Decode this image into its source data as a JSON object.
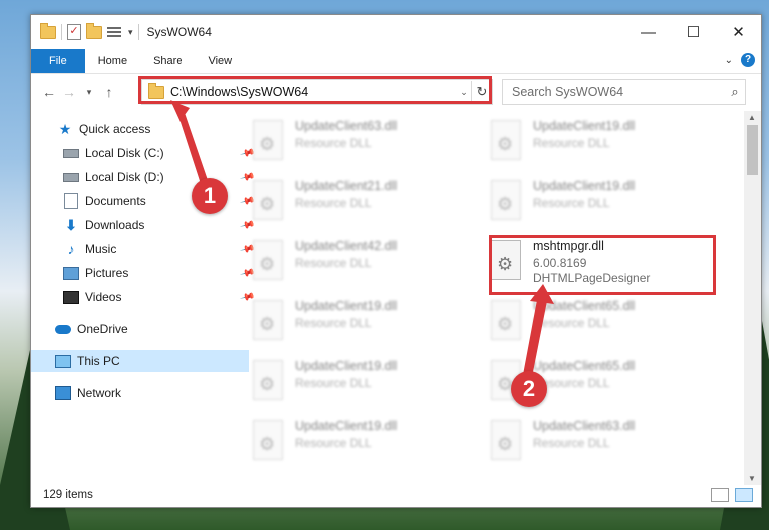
{
  "window": {
    "title": "SysWOW64",
    "controls": {
      "minimize": "—",
      "maximize": "☐",
      "close": "✕"
    }
  },
  "ribbon": {
    "tabs": [
      "File",
      "Home",
      "Share",
      "View"
    ],
    "help": "?"
  },
  "navigation": {
    "address_path": "C:\\Windows\\SysWOW64",
    "search_placeholder": "Search SysWOW64"
  },
  "sidebar": {
    "items": [
      {
        "label": "Quick access",
        "icon": "star-icon",
        "pinned": false
      },
      {
        "label": "Local Disk (C:)",
        "icon": "drive-icon",
        "pinned": true
      },
      {
        "label": "Local Disk (D:)",
        "icon": "drive-icon",
        "pinned": true
      },
      {
        "label": "Documents",
        "icon": "documents-icon",
        "pinned": true
      },
      {
        "label": "Downloads",
        "icon": "download-icon",
        "pinned": true
      },
      {
        "label": "Music",
        "icon": "music-icon",
        "pinned": true
      },
      {
        "label": "Pictures",
        "icon": "pictures-icon",
        "pinned": true
      },
      {
        "label": "Videos",
        "icon": "videos-icon",
        "pinned": true
      },
      {
        "label": "OneDrive",
        "icon": "onedrive-icon",
        "pinned": false
      },
      {
        "label": "This PC",
        "icon": "computer-icon",
        "pinned": false,
        "selected": true
      },
      {
        "label": "Network",
        "icon": "network-icon",
        "pinned": false
      }
    ]
  },
  "files": [
    {
      "name": "UpdateClient63.dll",
      "line2": "Resource DLL",
      "line3": "",
      "blurred": true
    },
    {
      "name": "UpdateClient19.dll",
      "line2": "Resource DLL",
      "line3": "",
      "blurred": true
    },
    {
      "name": "UpdateClient21.dll",
      "line2": "Resource DLL",
      "line3": "",
      "blurred": true
    },
    {
      "name": "UpdateClient19.dll",
      "line2": "Resource DLL",
      "line3": "",
      "blurred": true
    },
    {
      "name": "UpdateClient42.dll",
      "line2": "Resource DLL",
      "line3": "",
      "blurred": true
    },
    {
      "name": "mshtmpgr.dll",
      "line2": "6.00.8169",
      "line3": "DHTMLPageDesigner",
      "blurred": false
    },
    {
      "name": "UpdateClient19.dll",
      "line2": "Resource DLL",
      "line3": "",
      "blurred": true
    },
    {
      "name": "UpdateClient65.dll",
      "line2": "Resource DLL",
      "line3": "",
      "blurred": true
    },
    {
      "name": "UpdateClient19.dll",
      "line2": "Resource DLL",
      "line3": "",
      "blurred": true
    },
    {
      "name": "UpdateClient65.dll",
      "line2": "Resource DLL",
      "line3": "",
      "blurred": true
    },
    {
      "name": "UpdateClient19.dll",
      "line2": "Resource DLL",
      "line3": "",
      "blurred": true
    },
    {
      "name": "UpdateClient63.dll",
      "line2": "Resource DLL",
      "line3": "",
      "blurred": true
    }
  ],
  "status": {
    "item_count": "129 items"
  },
  "annotations": {
    "callouts": [
      "1",
      "2"
    ],
    "highlight_color": "#d9373a"
  }
}
